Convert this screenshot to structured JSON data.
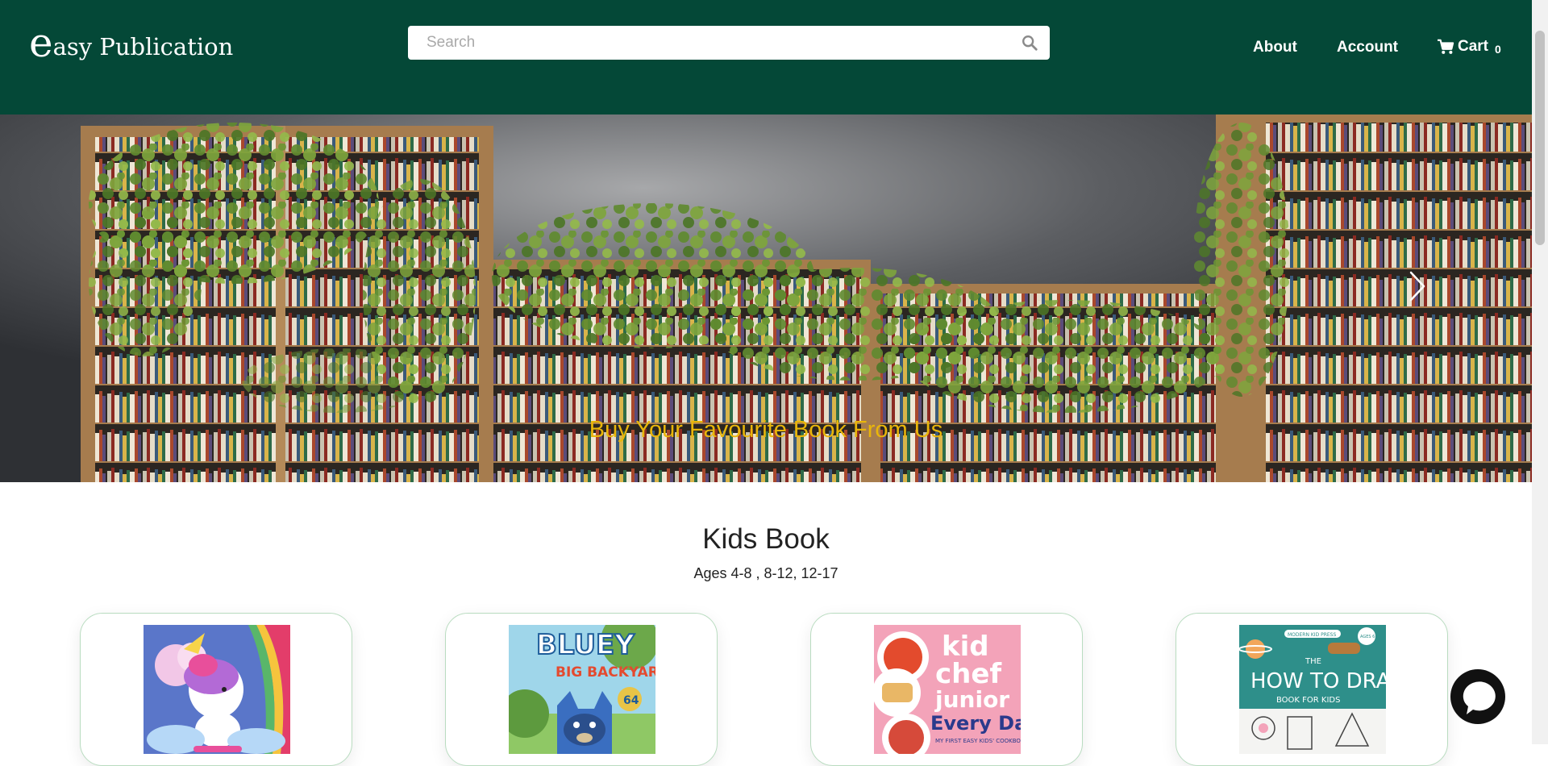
{
  "brand": {
    "logo_initial": "e",
    "logo_rest": "asy Publication"
  },
  "search": {
    "placeholder": "Search",
    "icon": "search-icon"
  },
  "nav": {
    "about": "About",
    "account": "Account",
    "cart_label": "Cart",
    "cart_count": "0",
    "cart_icon": "shopping-cart-icon"
  },
  "hero": {
    "caption": "Buy Your Favourite Book From Us",
    "next_icon": "chevron-right-icon"
  },
  "kids_section": {
    "title": "Kids Book",
    "subtitle": "Ages 4-8 , 8-12, 12-17"
  },
  "books": [
    {
      "cover_text": ""
    },
    {
      "cover_title": "BLUEY",
      "cover_subtitle": "BIG BACKYARD",
      "badge": "64"
    },
    {
      "cover_line1": "kid",
      "cover_line2": "chef",
      "cover_line3": "junior",
      "cover_line4": "Every Day",
      "cover_tagline": "MY FIRST EASY KIDS' COOKBOOK"
    },
    {
      "cover_top": "MODERN KID PRESS",
      "cover_age": "AGES 6+",
      "cover_the": "THE",
      "cover_title": "HOW TO DRAW",
      "cover_subtitle": "BOOK FOR KIDS"
    }
  ],
  "colors": {
    "header_bg": "#044837",
    "caption": "#e9b60a",
    "card_border": "#b9dcc0"
  },
  "chat": {
    "icon": "chat-bubble-icon"
  }
}
